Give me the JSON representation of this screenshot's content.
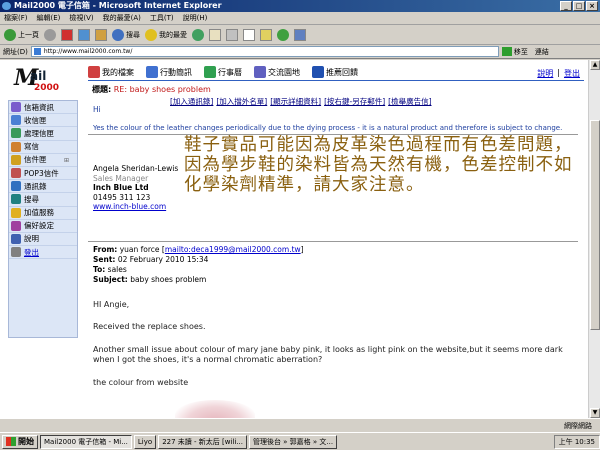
{
  "window": {
    "title": "Mail2000 電子信箱 - Microsoft Internet Explorer",
    "buttons": [
      "_",
      "□",
      "×"
    ]
  },
  "menu": [
    "檔案(F)",
    "編輯(E)",
    "檢視(V)",
    "我的最愛(A)",
    "工具(T)",
    "說明(H)"
  ],
  "toolbar": {
    "back": "上一頁",
    "search": "搜尋",
    "favorites": "我的最愛"
  },
  "address": {
    "label": "網址(D)",
    "url": "http://www.mail2000.com.tw/",
    "go": "移至",
    "links": "連結"
  },
  "logo": {
    "mark": "M",
    "word": "ail",
    "num": "2000"
  },
  "topnav": [
    "我的檔案",
    "行動簡訊",
    "行事曆",
    "交流園地",
    "推薦回饋"
  ],
  "toplinks": {
    "help": "說明",
    "logout": "登出",
    "sep": "|"
  },
  "sidebar": [
    {
      "label": "信箱資訊",
      "color": "#7a5ccc"
    },
    {
      "label": "收信匣",
      "color": "#4a7fd4"
    },
    {
      "label": "處理信匣",
      "color": "#3a9a5a"
    },
    {
      "label": "寫信",
      "color": "#d08030"
    },
    {
      "label": "信件匣",
      "color": "#d0a020",
      "extra": "⊞"
    },
    {
      "label": "POP3信件",
      "color": "#c05050"
    },
    {
      "label": "通訊錄",
      "color": "#3070c0"
    },
    {
      "label": "搜尋",
      "color": "#208080"
    },
    {
      "label": "加值服務",
      "color": "#e0b020"
    },
    {
      "label": "偏好設定",
      "color": "#a040a0"
    },
    {
      "label": "說明",
      "color": "#4060b0"
    },
    {
      "label": "登出",
      "color": "#808080"
    }
  ],
  "message": {
    "subject_key": "標題:",
    "subject": "RE: baby shoes problem",
    "actions": [
      "[加入通訊錄]",
      "[加入擋外名單]",
      "[顯示詳細資料]",
      "[按右鍵-另存郵件]",
      "[檢舉廣告信]"
    ],
    "greeting": "Hi",
    "leather_note": "Yes the colour of the leather changes periodically due to the dying process - it is a natural product and therefore is subject to change.",
    "chinese_note": "鞋子實品可能因為皮革染色過程而有色差問題，因為學步鞋的染料皆為天然有機，色差控制不如化學染劑精準，請大家注意。",
    "signature": {
      "name": "Angela Sheridan-Lewis",
      "title": "Sales Manager",
      "company": "Inch Blue Ltd",
      "phone": "01495 311 123",
      "site": "www.inch-blue.com"
    },
    "headers": {
      "from_key": "From:",
      "from_name": "yuan force [",
      "from_mailto": "mailto:deca1999@mail2000.com.tw",
      "from_end": "]",
      "sent_key": "Sent:",
      "sent": "02 February 2010 15:34",
      "to_key": "To:",
      "to": "sales",
      "subject_key": "Subject:",
      "subject": "baby shoes problem"
    },
    "body": [
      "HI Angie,",
      "Received the replace shoes.",
      "Another small issue about colour of  mary jane baby pink, it looks as light pink on the website,but it seems more dark when I got  the shoes, it's a normal chromatic aberration?",
      "the colour from website"
    ]
  },
  "status": {
    "zone": "網際網路"
  },
  "taskbar": {
    "start": "開始",
    "tasks": [
      "Mail2000 電子信箱 - Mi...",
      "Liyo",
      "227 未讀 - 新太后 [wili...",
      "管理後台 » 郭嘉格 » 文..."
    ],
    "clock": "上午 10:35"
  }
}
